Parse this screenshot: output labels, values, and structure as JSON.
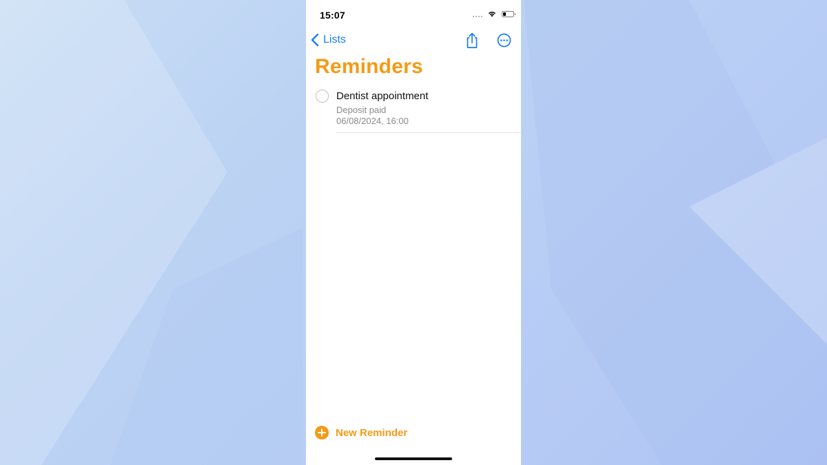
{
  "status_bar": {
    "time": "15:07",
    "signal_icon": "cellular-signal-icon",
    "wifi_icon": "wifi-icon",
    "battery_icon": "battery-icon",
    "battery_level": 0.3
  },
  "nav": {
    "back_label": "Lists",
    "back_icon": "chevron-left-icon",
    "share_icon": "share-icon",
    "more_icon": "ellipsis-circle-icon"
  },
  "list": {
    "title": "Reminders",
    "accent_color": "#f59a15",
    "link_color": "#1a7cf5"
  },
  "reminders": [
    {
      "title": "Dentist appointment",
      "notes": "Deposit paid",
      "date": "06/08/2024, 16:00",
      "completed": false
    }
  ],
  "footer": {
    "new_reminder_label": "New Reminder",
    "new_reminder_icon": "plus-circle-icon"
  }
}
